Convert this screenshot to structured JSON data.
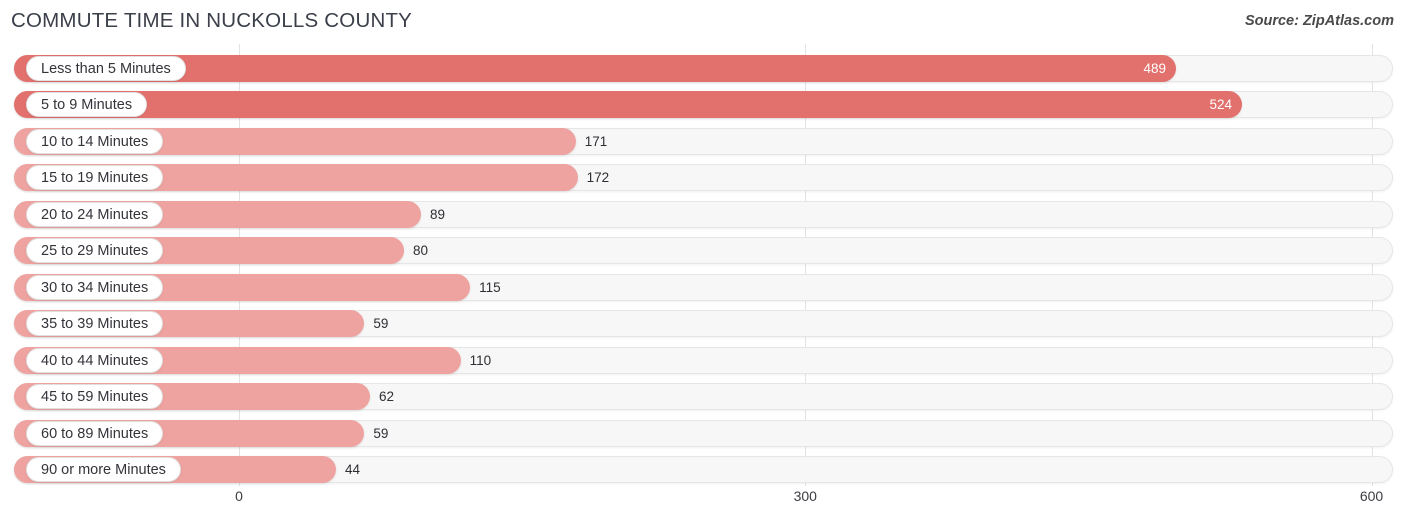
{
  "header": {
    "title": "COMMUTE TIME IN NUCKOLLS COUNTY",
    "source": "Source: ZipAtlas.com"
  },
  "colors": {
    "bar_dark": "#e2706c",
    "bar_light": "#efa3a0",
    "track": "#f7f7f7",
    "gridline": "#e3e3e3",
    "title_text": "#3b3f4a",
    "label_text": "#33333a"
  },
  "axis": {
    "ticks": [
      "0",
      "300",
      "600"
    ],
    "min": 0,
    "max": 600
  },
  "chart_data": {
    "type": "bar",
    "orientation": "horizontal",
    "title": "COMMUTE TIME IN NUCKOLLS COUNTY",
    "subtitle": "",
    "xlabel": "",
    "ylabel": "",
    "xlim": [
      0,
      600
    ],
    "grid": true,
    "legend": "none",
    "source": "Source: ZipAtlas.com",
    "categories": [
      "Less than 5 Minutes",
      "5 to 9 Minutes",
      "10 to 14 Minutes",
      "15 to 19 Minutes",
      "20 to 24 Minutes",
      "25 to 29 Minutes",
      "30 to 34 Minutes",
      "35 to 39 Minutes",
      "40 to 44 Minutes",
      "45 to 59 Minutes",
      "60 to 89 Minutes",
      "90 or more Minutes"
    ],
    "values": [
      489,
      524,
      171,
      172,
      89,
      80,
      115,
      59,
      110,
      62,
      59,
      44
    ],
    "tick_labels": [
      "0",
      "300",
      "600"
    ],
    "tick_values": [
      0,
      300,
      600
    ]
  },
  "rows": [
    {
      "label": "Less than 5 Minutes",
      "value": "489",
      "shade": "dark",
      "inside": true
    },
    {
      "label": "5 to 9 Minutes",
      "value": "524",
      "shade": "dark",
      "inside": true
    },
    {
      "label": "10 to 14 Minutes",
      "value": "171",
      "shade": "light",
      "inside": false
    },
    {
      "label": "15 to 19 Minutes",
      "value": "172",
      "shade": "light",
      "inside": false
    },
    {
      "label": "20 to 24 Minutes",
      "value": "89",
      "shade": "light",
      "inside": false
    },
    {
      "label": "25 to 29 Minutes",
      "value": "80",
      "shade": "light",
      "inside": false
    },
    {
      "label": "30 to 34 Minutes",
      "value": "115",
      "shade": "light",
      "inside": false
    },
    {
      "label": "35 to 39 Minutes",
      "value": "59",
      "shade": "light",
      "inside": false
    },
    {
      "label": "40 to 44 Minutes",
      "value": "110",
      "shade": "light",
      "inside": false
    },
    {
      "label": "45 to 59 Minutes",
      "value": "62",
      "shade": "light",
      "inside": false
    },
    {
      "label": "60 to 89 Minutes",
      "value": "59",
      "shade": "light",
      "inside": false
    },
    {
      "label": "90 or more Minutes",
      "value": "44",
      "shade": "light",
      "inside": false
    }
  ]
}
